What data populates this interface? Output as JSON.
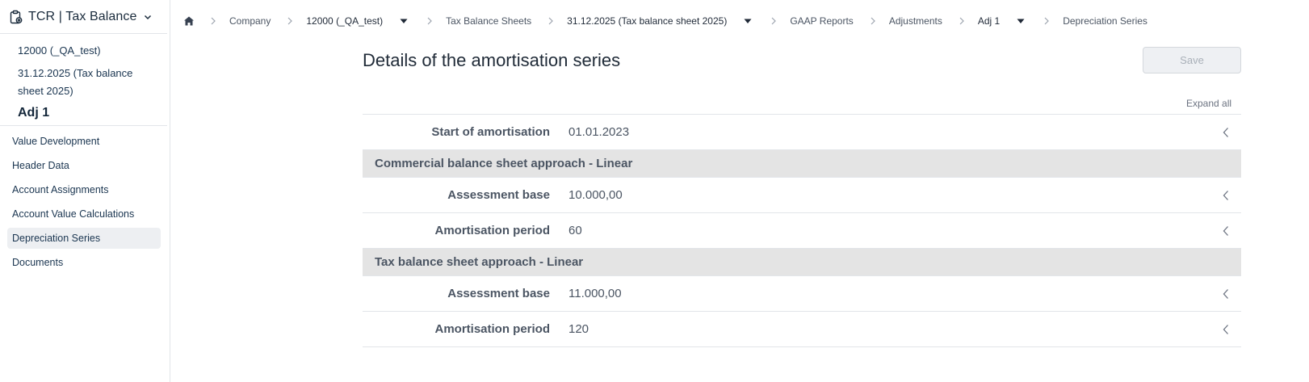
{
  "app": {
    "title": "TCR | Tax Balance",
    "icon": "clipboard-gear-icon",
    "switch_icon": "chevron-down-icon"
  },
  "context": {
    "level1": "12000 (_QA_test)",
    "level2": "31.12.2025 (Tax balance sheet 2025)",
    "level3": "Adj 1"
  },
  "nav": {
    "items": [
      {
        "label": "Value Development"
      },
      {
        "label": "Header Data"
      },
      {
        "label": "Account Assignments"
      },
      {
        "label": "Account Value Calculations"
      },
      {
        "label": "Depreciation Series",
        "active": true
      },
      {
        "label": "Documents"
      }
    ]
  },
  "breadcrumb": {
    "home_icon": "home-icon",
    "items": [
      {
        "label": "Company"
      },
      {
        "label": "12000 (_QA_test)",
        "dropdown": true
      },
      {
        "label": "Tax Balance Sheets"
      },
      {
        "label": "31.12.2025 (Tax balance sheet 2025)",
        "dropdown": true
      },
      {
        "label": "GAAP Reports"
      },
      {
        "label": "Adjustments"
      },
      {
        "label": "Adj 1",
        "dropdown": true
      },
      {
        "label": "Depreciation Series"
      }
    ]
  },
  "main": {
    "title": "Details of the amortisation series",
    "save_label": "Save",
    "expand_all_label": "Expand all",
    "start_row": {
      "label": "Start of amortisation",
      "value": "01.01.2023"
    },
    "sections": [
      {
        "title": "Commercial balance sheet approach - Linear",
        "rows": [
          {
            "label": "Assessment base",
            "value": "10.000,00"
          },
          {
            "label": "Amortisation period",
            "value": "60"
          }
        ]
      },
      {
        "title": "Tax balance sheet approach - Linear",
        "rows": [
          {
            "label": "Assessment base",
            "value": "11.000,00"
          },
          {
            "label": "Amortisation period",
            "value": "120"
          }
        ]
      }
    ],
    "row_expand_icon": "chevron-left-icon"
  },
  "colors": {
    "section_bg": "#e4e4e4",
    "active_nav_bg": "#edeff2",
    "text_primary": "#1f2a37",
    "text_muted": "#4b5563"
  }
}
